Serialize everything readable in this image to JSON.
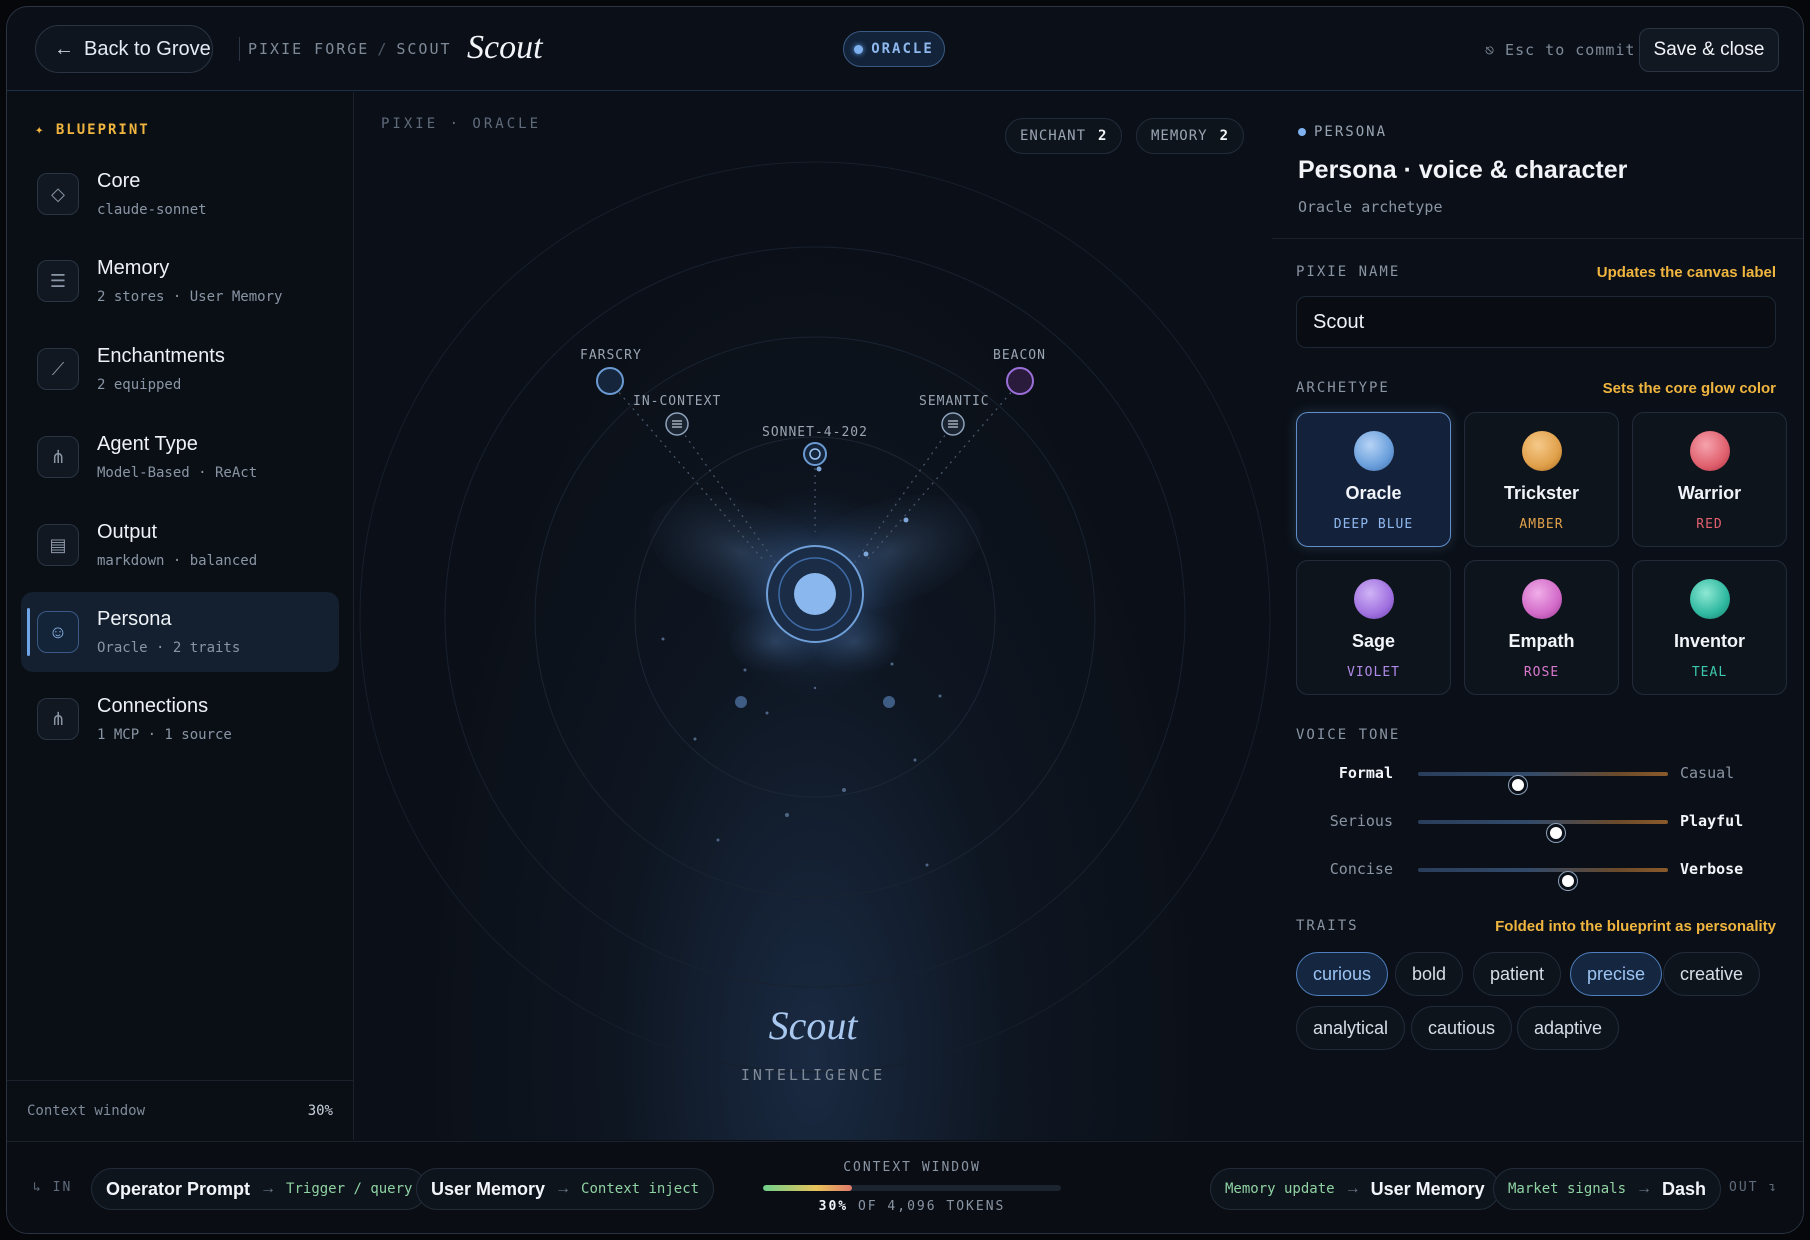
{
  "header": {
    "back_label": "Back to Grove",
    "breadcrumb": [
      "PIXIE FORGE",
      "SCOUT"
    ],
    "title": "Scout",
    "badge": "ORACLE",
    "esc_hint": "⎋ Esc to commit",
    "save_label": "Save & close"
  },
  "sidebar": {
    "heading": "BLUEPRINT",
    "items": [
      {
        "title": "Core",
        "sub": "claude-sonnet",
        "icon": "gem-icon"
      },
      {
        "title": "Memory",
        "sub": "2 stores · User Memory",
        "icon": "memory-icon"
      },
      {
        "title": "Enchantments",
        "sub": "2 equipped",
        "icon": "wand-icon"
      },
      {
        "title": "Agent Type",
        "sub": "Model-Based · ReAct",
        "icon": "branch-icon"
      },
      {
        "title": "Output",
        "sub": "markdown · balanced",
        "icon": "document-icon"
      },
      {
        "title": "Persona",
        "sub": "Oracle · 2 traits",
        "icon": "mask-icon",
        "active": true
      },
      {
        "title": "Connections",
        "sub": "1 MCP · 1 source",
        "icon": "link-icon"
      }
    ],
    "context_label": "Context window",
    "context_value": "30%"
  },
  "canvas": {
    "label": "PIXIE · ORACLE",
    "chips": [
      {
        "label": "ENCHANT",
        "count": "2"
      },
      {
        "label": "MEMORY",
        "count": "2"
      }
    ],
    "nodes": {
      "farscry": "FARSCRY",
      "beacon": "BEACON",
      "in_context": "IN-CONTEXT",
      "semantic": "SEMANTIC",
      "model": "SONNET-4-202"
    },
    "pixie_name": "Scout",
    "pixie_role": "INTELLIGENCE"
  },
  "panel": {
    "tag": "PERSONA",
    "title": "Persona · voice & character",
    "subtitle": "Oracle archetype",
    "name_label": "PIXIE NAME",
    "name_note": "Updates the canvas label",
    "name_value": "Scout",
    "archetype_label": "ARCHETYPE",
    "archetype_note": "Sets the core glow color",
    "archetypes": [
      {
        "name": "Oracle",
        "color_name": "DEEP BLUE",
        "color": "#7fb1f0",
        "selected": true
      },
      {
        "name": "Trickster",
        "color_name": "AMBER",
        "color": "#e0a04a"
      },
      {
        "name": "Warrior",
        "color_name": "RED",
        "color": "#e0606e"
      },
      {
        "name": "Sage",
        "color_name": "VIOLET",
        "color": "#a071e0"
      },
      {
        "name": "Empath",
        "color_name": "ROSE",
        "color": "#d26ac8"
      },
      {
        "name": "Inventor",
        "color_name": "TEAL",
        "color": "#2fb8a0"
      }
    ],
    "voice_label": "VOICE TONE",
    "tones": [
      {
        "left": "Formal",
        "right": "Casual",
        "value": 0.4,
        "bold": "left"
      },
      {
        "left": "Serious",
        "right": "Playful",
        "value": 0.55,
        "bold": "right"
      },
      {
        "left": "Concise",
        "right": "Verbose",
        "value": 0.6,
        "bold": "right"
      }
    ],
    "traits_label": "TRAITS",
    "traits_note": "Folded into the blueprint as personality",
    "traits": [
      {
        "label": "curious",
        "on": true
      },
      {
        "label": "bold",
        "on": false
      },
      {
        "label": "patient",
        "on": false
      },
      {
        "label": "precise",
        "on": true
      },
      {
        "label": "creative",
        "on": false
      },
      {
        "label": "analytical",
        "on": false
      },
      {
        "label": "cautious",
        "on": false
      },
      {
        "label": "adaptive",
        "on": false
      }
    ]
  },
  "bottom": {
    "in_label": "↳ IN",
    "out_label": "OUT ↴",
    "inputs": [
      {
        "source": "Operator Prompt",
        "target": "Trigger / query"
      },
      {
        "source": "User Memory",
        "target": "Context inject"
      }
    ],
    "outputs": [
      {
        "source": "Memory update",
        "target": "User Memory"
      },
      {
        "source": "Market signals",
        "target": "Dash"
      }
    ],
    "context_label": "CONTEXT WINDOW",
    "context_percent": "30%",
    "context_fraction": 0.3,
    "context_tokens": "OF 4,096 TOKENS"
  }
}
